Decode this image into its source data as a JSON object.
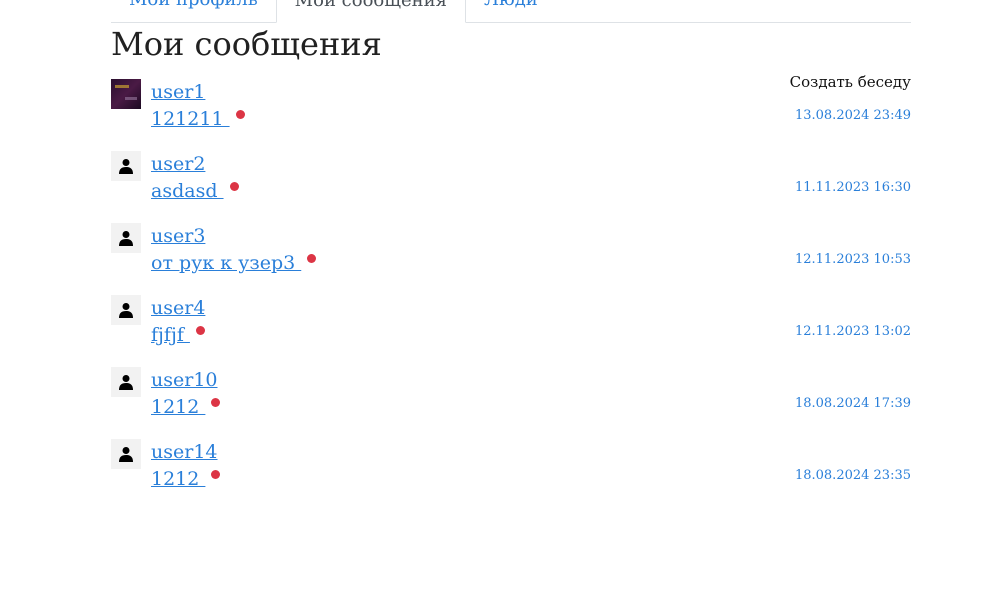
{
  "tabs": [
    {
      "label": "Мой профиль",
      "active": false
    },
    {
      "label": "Мои сообщения",
      "active": true
    },
    {
      "label": "Люди",
      "active": false
    }
  ],
  "page_title": "Мои сообщения",
  "create_chat_label": "Создать беседу",
  "colors": {
    "link": "#2a7fd9",
    "unread": "#dc3545",
    "text": "#212121"
  },
  "conversations": [
    {
      "username": "user1",
      "last_message": "121211 ",
      "timestamp": "13.08.2024 23:49",
      "avatar": "photo",
      "unread": true
    },
    {
      "username": "user2",
      "last_message": "asdasd ",
      "timestamp": "11.11.2023 16:30",
      "avatar": "user-icon",
      "unread": true
    },
    {
      "username": "user3",
      "last_message": "от рук к узер3 ",
      "timestamp": "12.11.2023 10:53",
      "avatar": "user-icon",
      "unread": true
    },
    {
      "username": "user4",
      "last_message": "fjfjf ",
      "timestamp": "12.11.2023 13:02",
      "avatar": "user-icon",
      "unread": true
    },
    {
      "username": "user10",
      "last_message": "1212 ",
      "timestamp": "18.08.2024 17:39",
      "avatar": "user-icon",
      "unread": true
    },
    {
      "username": "user14",
      "last_message": "1212 ",
      "timestamp": "18.08.2024 23:35",
      "avatar": "user-icon",
      "unread": true
    }
  ]
}
